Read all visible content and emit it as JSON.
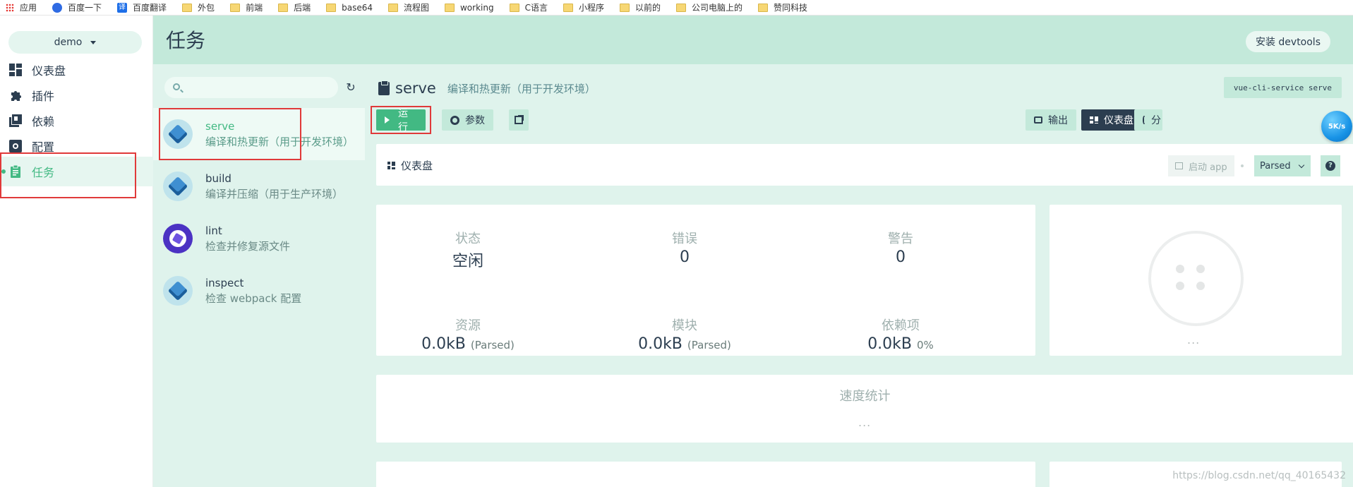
{
  "bookmarks": [
    {
      "label": "应用",
      "icon": "apps-icon"
    },
    {
      "label": "百度一下",
      "icon": "baidu-icon"
    },
    {
      "label": "百度翻译",
      "icon": "translate-icon"
    },
    {
      "label": "外包",
      "icon": "folder-icon"
    },
    {
      "label": "前端",
      "icon": "folder-icon"
    },
    {
      "label": "后端",
      "icon": "folder-icon"
    },
    {
      "label": "base64",
      "icon": "folder-icon"
    },
    {
      "label": "流程图",
      "icon": "folder-icon"
    },
    {
      "label": "working",
      "icon": "folder-icon"
    },
    {
      "label": "C语言",
      "icon": "folder-icon"
    },
    {
      "label": "小程序",
      "icon": "folder-icon"
    },
    {
      "label": "以前的",
      "icon": "folder-icon"
    },
    {
      "label": "公司电脑上的",
      "icon": "folder-icon"
    },
    {
      "label": "赞同科技",
      "icon": "folder-icon"
    }
  ],
  "sidebar": {
    "project": "demo",
    "items": [
      {
        "label": "仪表盘",
        "icon": "dashboard-icon",
        "active": false
      },
      {
        "label": "插件",
        "icon": "puzzle-icon",
        "active": false
      },
      {
        "label": "依赖",
        "icon": "library-icon",
        "active": false
      },
      {
        "label": "配置",
        "icon": "settings-icon",
        "active": false
      },
      {
        "label": "任务",
        "icon": "clipboard-icon",
        "active": true
      }
    ]
  },
  "header": {
    "title": "任务",
    "devtools_label": "安装 devtools"
  },
  "tasklist": {
    "search_placeholder": "",
    "tasks": [
      {
        "name": "serve",
        "desc": "编译和热更新（用于开发环境）",
        "icon": "webpack-icon",
        "selected": true
      },
      {
        "name": "build",
        "desc": "编译并压缩（用于生产环境）",
        "icon": "webpack-icon",
        "selected": false
      },
      {
        "name": "lint",
        "desc": "检查并修复源文件",
        "icon": "eslint-icon",
        "selected": false
      },
      {
        "name": "inspect",
        "desc": "检查 webpack 配置",
        "icon": "webpack-inspect-icon",
        "selected": false
      }
    ]
  },
  "task": {
    "name": "serve",
    "desc": "编译和热更新（用于开发环境）",
    "command": "vue-cli-service serve",
    "run_label": "运行",
    "params_label": "参数",
    "output_label": "输出",
    "dashboard_label": "仪表盘",
    "analyze_label": "分",
    "speed_badge": "5K/s"
  },
  "dashboard": {
    "title": "仪表盘",
    "launch_label": "启动 app",
    "mode_select": "Parsed",
    "help": "?",
    "stats": [
      {
        "label": "状态",
        "value": "空闲",
        "suffix": ""
      },
      {
        "label": "错误",
        "value": "0",
        "suffix": ""
      },
      {
        "label": "警告",
        "value": "0",
        "suffix": ""
      },
      {
        "label": "资源",
        "value": "0.0kB",
        "suffix": "(Parsed)"
      },
      {
        "label": "模块",
        "value": "0.0kB",
        "suffix": "(Parsed)"
      },
      {
        "label": "依赖项",
        "value": "0.0kB",
        "suffix": "0%"
      }
    ],
    "empty_dots": "...",
    "speed_title": "速度统计",
    "speed_dots": "..."
  },
  "watermark": "https://blog.csdn.net/qq_40165432",
  "colors": {
    "accent": "#42b983",
    "dark": "#2c3e50",
    "header": "#c3e9da",
    "panel": "#dff3ec"
  }
}
